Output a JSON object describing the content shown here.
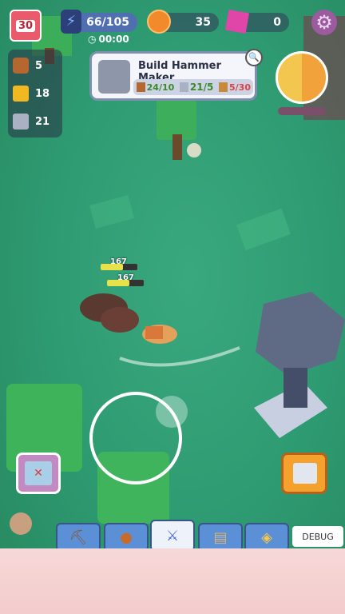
{
  "hud": {
    "calendar_day": "30",
    "energy_text": "66/105",
    "timer_text": "00:00",
    "coins": "35",
    "gems": "0"
  },
  "resources": [
    {
      "icon": "wood-icon",
      "value": "5"
    },
    {
      "icon": "gold-bars-icon",
      "value": "18"
    },
    {
      "icon": "stone-icon",
      "value": "21"
    }
  ],
  "quest": {
    "title": "Build Hammer Maker",
    "req_wood": "24/10",
    "req_stone": "21/5",
    "req_other": "5/30"
  },
  "enemies": [
    {
      "hp_label": "167"
    },
    {
      "hp_label": "167"
    }
  ],
  "toolbar": {
    "items": [
      "pickaxe-icon",
      "meat-icon",
      "sword-icon",
      "scroll-icon",
      "compass-icon"
    ],
    "active_index": 2
  },
  "debug_label": "DEBUG",
  "colors": {
    "grass": "#2f9a72",
    "toolbar_blue": "#5b8fd6",
    "hud_pill": "#323c5a"
  }
}
